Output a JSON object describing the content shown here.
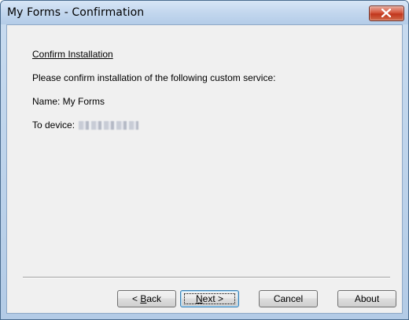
{
  "window": {
    "title": "My Forms - Confirmation"
  },
  "content": {
    "heading": "Confirm Installation",
    "prompt": "Please confirm installation of the following custom service:",
    "name_line": "Name: My Forms",
    "device_label": "To device:"
  },
  "buttons": {
    "back": {
      "pre": "< ",
      "mnemonic": "B",
      "rest": "ack"
    },
    "next": {
      "mnemonic": "N",
      "rest": "ext >"
    },
    "cancel": "Cancel",
    "about": "About"
  },
  "icons": {
    "close": "close-icon"
  },
  "colors": {
    "titlebar": "#c3d7ee",
    "close_button": "#c0361c",
    "client_bg": "#f0f0f0",
    "focus_border": "#3c7fb1"
  }
}
